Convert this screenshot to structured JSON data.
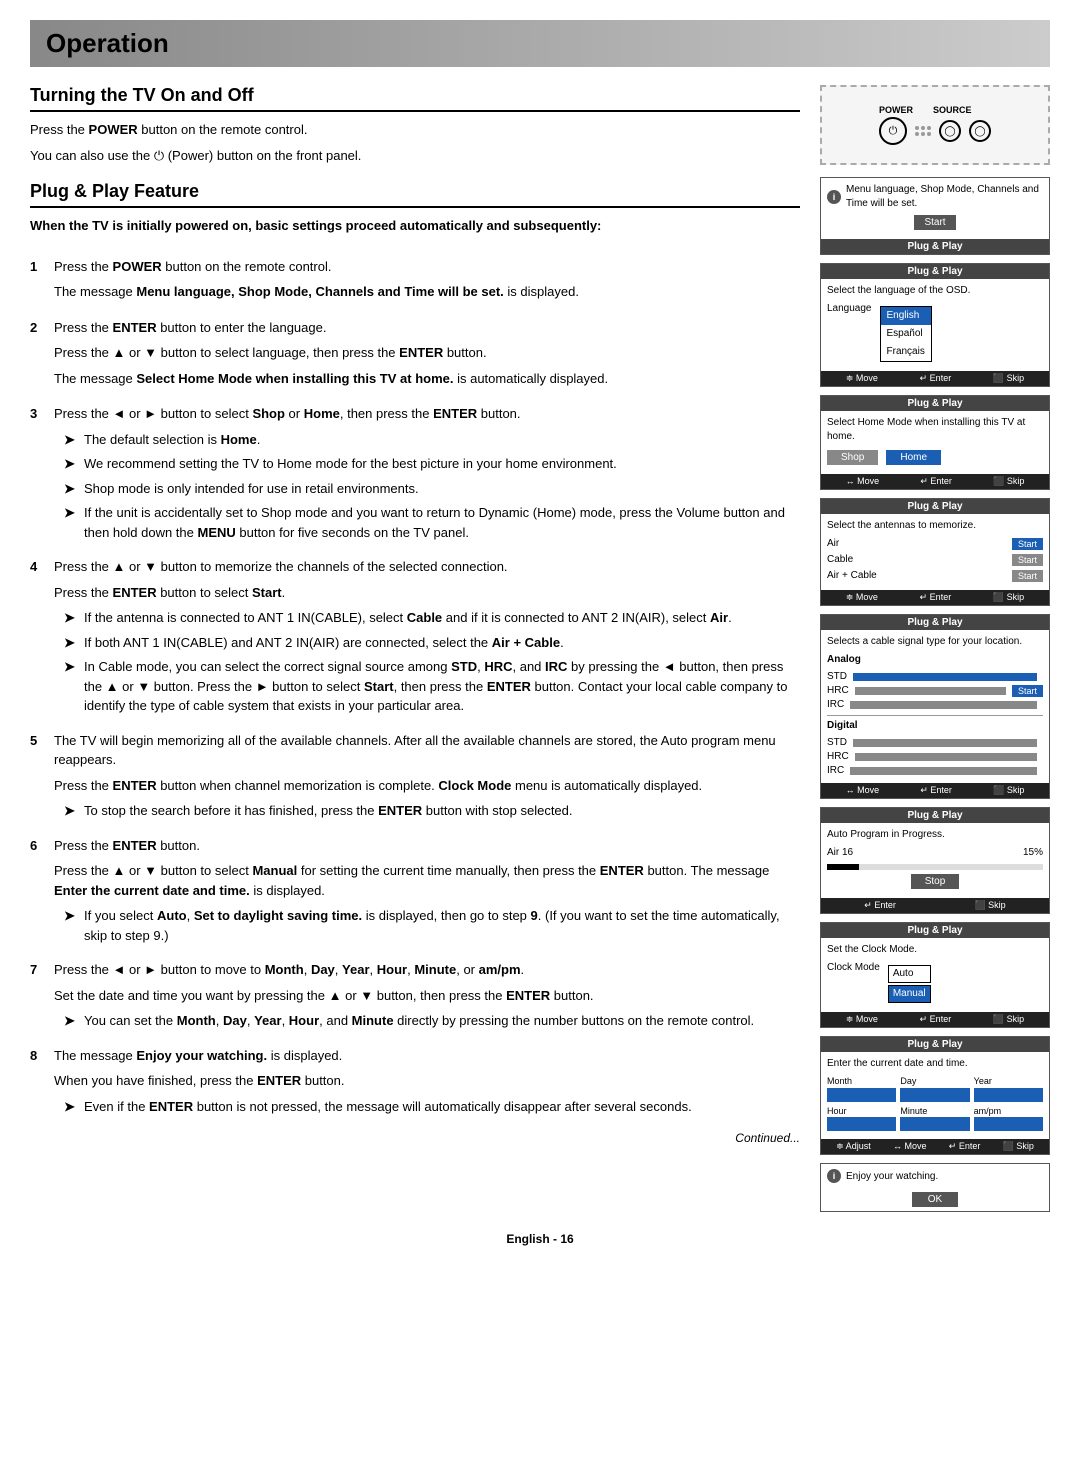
{
  "header": {
    "title": "Operation"
  },
  "section1": {
    "title": "Turning the TV On and Off",
    "p1": "Press the ",
    "p1_bold": "POWER",
    "p1_end": " button on the remote control.",
    "p2_start": "You can also use the ",
    "p2_power": "⏻",
    "p2_end": " (Power) button on the front panel."
  },
  "section2": {
    "title": "Plug & Play Feature",
    "intro_bold": "When the TV is initially powered on, basic settings proceed automatically and subsequently:"
  },
  "steps": [
    {
      "num": "1",
      "text_start": "Press the ",
      "bold1": "POWER",
      "text_mid": " button on the remote control.",
      "text2_start": "The message ",
      "bold2": "Menu language, Shop Mode, Channels and Time will be set.",
      "text2_end": " is displayed."
    },
    {
      "num": "2",
      "text1": "Press the ",
      "bold1": "ENTER",
      "text1_end": " button to enter the language.",
      "text2": "Press the ▲ or ▼ button to select language, then press the ",
      "bold2": "ENTER",
      "text2_end": " button.",
      "text3": "The message ",
      "bold3": "Select Home Mode when installing this TV at home.",
      "text3_end": " is automatically displayed."
    },
    {
      "num": "3",
      "text1": "Press the ◄ or ► button to select ",
      "bold1": "Shop",
      "text1_mid": " or ",
      "bold2": "Home",
      "text1_end": ", then press the ",
      "bold3": "ENTER",
      "text1_end2": " button.",
      "bullets": [
        "The default selection is Home.",
        "We recommend setting the TV to Home mode for the best picture in your home environment.",
        "Shop mode is only intended for use in retail environments.",
        "If the unit is accidentally set to Shop mode and you want to return to Dynamic (Home) mode, press the Volume button and then hold down the MENU button for five seconds on the TV panel."
      ]
    },
    {
      "num": "4",
      "text1": "Press the ▲ or ▼ button to memorize the channels of the selected connection.",
      "text2": "Press the ",
      "bold2": "ENTER",
      "text2_end": " button to select Start.",
      "bullets": [
        "If the antenna is connected to ANT 1 IN(CABLE), select Cable and if it is connected to ANT 2 IN(AIR), select Air.",
        "If both ANT 1 IN(CABLE) and ANT 2 IN(AIR) are connected, select the Air + Cable.",
        "In Cable mode, you can select the correct signal source among STD, HRC, and IRC by pressing the ◄ button, then press the ▲ or ▼ button. Press the ► button to select Start, then press the ENTER button. Contact your local cable company to identify the type of cable system that exists in your particular area."
      ]
    },
    {
      "num": "5",
      "text1": "The TV will begin memorizing all of the available channels. After all the available channels are stored, the Auto program menu reappears.",
      "text2": "Press the ",
      "bold2": "ENTER",
      "text2_end": " button when channel memorization is complete. Clock Mode menu is automatically displayed.",
      "bullets": [
        "To stop the search before it has finished, press the ENTER button with stop selected."
      ]
    },
    {
      "num": "6",
      "text1": "Press the ",
      "bold1": "ENTER",
      "text1_end": " button.",
      "text2": "Press the ▲ or ▼ button to select ",
      "bold2": "Manual",
      "text2_mid": " for setting the current time manually, then press the ",
      "bold3": "ENTER",
      "text2_end": " button. The message ",
      "bold4": "Enter the current date and time.",
      "text2_end2": " is displayed.",
      "bullets": [
        "If you select Auto, Set to daylight saving time. is displayed, then go to step 9. (If you want to set the time automatically, skip to step 9.)"
      ]
    },
    {
      "num": "7",
      "text1": "Press the ◄ or ► button to move to ",
      "bold1": "Month",
      "text1_b": ", ",
      "bold2": "Day",
      "text1_c": ", ",
      "bold3": "Year",
      "text1_d": ", ",
      "bold4": "Hour",
      "text1_e": ", ",
      "bold5": "Minute",
      "text1_f": ", or ",
      "bold6": "am/pm",
      "text1_end": ".",
      "text2": "Set the date and time you want by pressing the ▲ or ▼ button, then press the ",
      "bold7": "ENTER",
      "text2_end": " button.",
      "bullets": [
        "You can set the Month, Day, Year, Hour, and Minute directly by pressing the number buttons on the remote control."
      ]
    },
    {
      "num": "8",
      "text1": "The message ",
      "bold1": "Enjoy your watching.",
      "text1_end": " is displayed.",
      "text2": "When you have finished, press the ",
      "bold2": "ENTER",
      "text2_end": " button.",
      "bullets": [
        "Even if the ENTER button is not pressed, the message will automatically disappear after several seconds."
      ]
    }
  ],
  "right_panel": {
    "tv_labels": {
      "power": "POWER",
      "source": "SOURCE"
    },
    "boxes": [
      {
        "id": "box1",
        "info": "Menu language, Shop Mode, Channels and Time will be set.",
        "btn": "Start",
        "header": "Plug & Play"
      },
      {
        "id": "box2",
        "header": "Plug & Play",
        "desc": "Select the language of the OSD.",
        "label": "Language",
        "langs": [
          "English",
          "Español",
          "Français"
        ],
        "selected_lang": "English",
        "footer": [
          "≑ Move",
          "↵ Enter",
          "⬛ Skip"
        ]
      },
      {
        "id": "box3",
        "header": "Plug & Play",
        "desc": "Select Home Mode when installing this TV at home.",
        "btns": [
          "Shop",
          "Home"
        ],
        "footer": [
          "↔ Move",
          "↵ Enter",
          "⬛ Skip"
        ]
      },
      {
        "id": "box4",
        "header": "Plug & Play",
        "desc": "Select the antennas to memorize.",
        "antennas": [
          "Air",
          "Cable",
          "Air + Cable"
        ],
        "footer": [
          "≑ Move",
          "↵ Enter",
          "⬛ Skip"
        ]
      },
      {
        "id": "box5",
        "header": "Plug & Play",
        "desc": "Selects a cable signal type for your location.",
        "analog_section": "Analog",
        "analog_items": [
          "STD",
          "HRC",
          "IRC"
        ],
        "digital_section": "Digital",
        "digital_items": [
          "STD",
          "HRC",
          "IRC"
        ],
        "footer": [
          "↔ Move",
          "↵ Enter",
          "⬛ Skip"
        ]
      },
      {
        "id": "box6",
        "header": "Plug & Play",
        "desc": "Auto Program in Progress.",
        "air_label": "Air 16",
        "pct": "15%",
        "btn": "Stop",
        "footer": [
          "↵ Enter",
          "⬛ Skip"
        ]
      },
      {
        "id": "box7",
        "header": "Plug & Play",
        "desc": "Set the Clock Mode.",
        "field_label": "Clock Mode",
        "options": [
          "Auto",
          "Manual"
        ],
        "selected": "Manual",
        "footer": [
          "≑ Move",
          "↵ Enter",
          "⬛ Skip"
        ]
      },
      {
        "id": "box8",
        "header": "Plug & Play",
        "desc": "Enter the current date and time.",
        "fields_row1": [
          "Month",
          "Day",
          "Year"
        ],
        "fields_row2": [
          "Hour",
          "Minute",
          "am/pm"
        ],
        "footer": [
          "≑ Adjust",
          "↔ Move",
          "↵ Enter",
          "⬛ Skip"
        ]
      }
    ],
    "enjoy_box": {
      "text": "Enjoy your watching.",
      "btn": "OK"
    }
  },
  "footer": {
    "continued": "Continued...",
    "language": "English",
    "page": "16",
    "label": "English - 16"
  }
}
